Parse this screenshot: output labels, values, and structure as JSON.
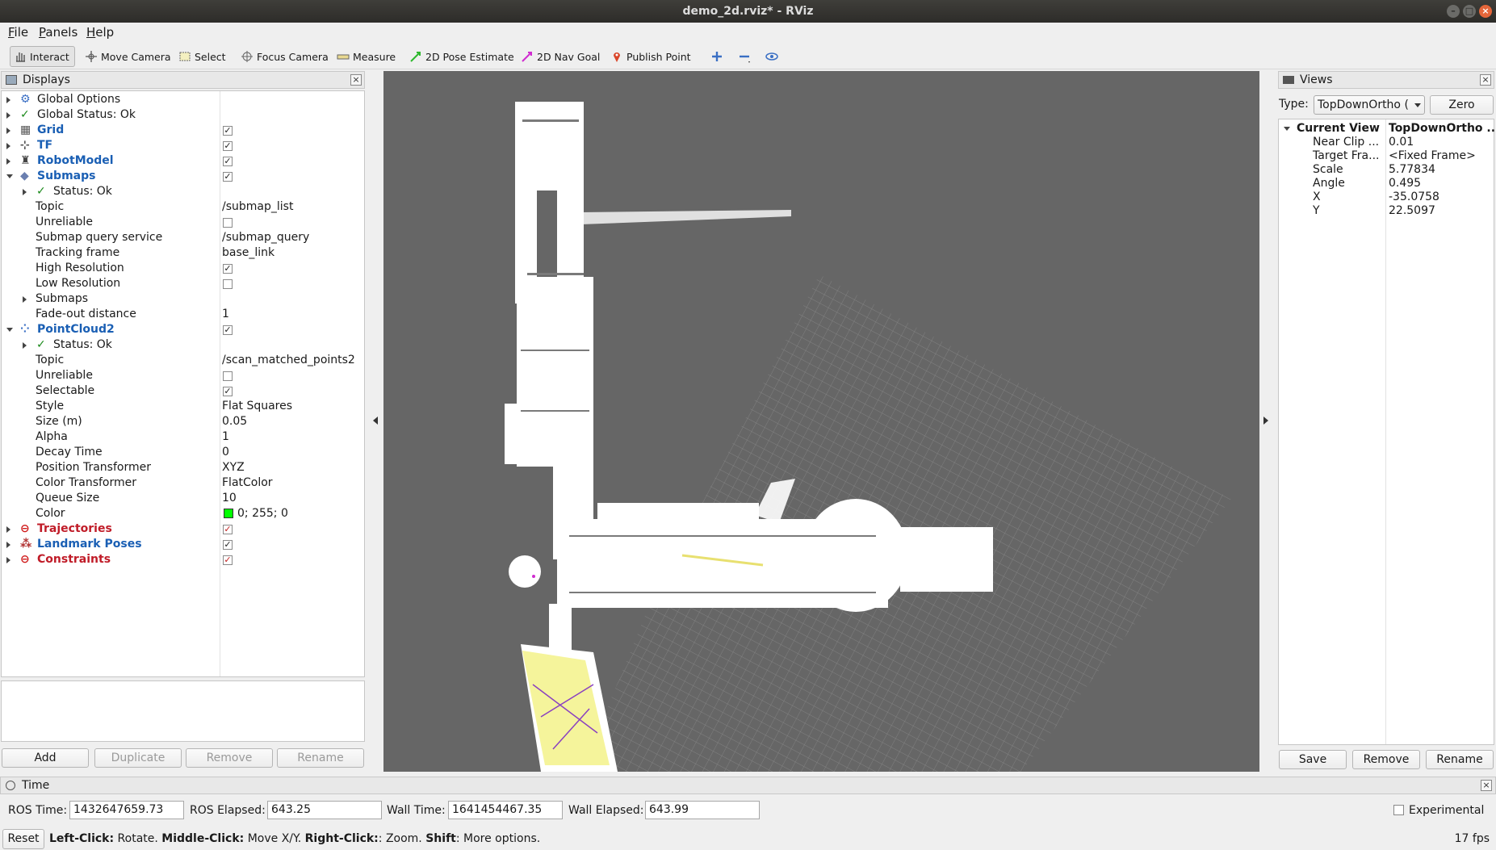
{
  "window": {
    "title": "demo_2d.rviz* - RViz"
  },
  "menu": [
    {
      "label": "File",
      "u": "F",
      "rest": "ile"
    },
    {
      "label": "Panels",
      "u": "P",
      "rest": "anels"
    },
    {
      "label": "Help",
      "u": "H",
      "rest": "elp"
    }
  ],
  "toolbar": {
    "interact": "Interact",
    "move_camera": "Move Camera",
    "select": "Select",
    "focus_camera": "Focus Camera",
    "measure": "Measure",
    "pose_estimate": "2D Pose Estimate",
    "nav_goal": "2D Nav Goal",
    "publish_point": "Publish Point"
  },
  "displays": {
    "title": "Displays",
    "rows": [
      {
        "label": "Global Options",
        "value": "",
        "style": "normal",
        "icon": "gear-icon"
      },
      {
        "label": "Global Status: Ok",
        "value": "",
        "style": "normal",
        "icon": "check-icon"
      },
      {
        "label": "Grid",
        "value": "",
        "style": "blue",
        "icon": "grid-icon",
        "checked": true
      },
      {
        "label": "TF",
        "value": "",
        "style": "blue",
        "icon": "axes-icon",
        "checked": true
      },
      {
        "label": "RobotModel",
        "value": "",
        "style": "blue",
        "icon": "robot-icon",
        "checked": true
      },
      {
        "label": "Submaps",
        "value": "",
        "style": "blue",
        "icon": "diamond-icon",
        "checked": true
      },
      {
        "label": "Status: Ok",
        "value": "",
        "style": "normal",
        "icon": "check-icon"
      },
      {
        "label": "Topic",
        "value": "/submap_list"
      },
      {
        "label": "Unreliable",
        "value": "",
        "checked": false
      },
      {
        "label": "Submap query service",
        "value": "/submap_query"
      },
      {
        "label": "Tracking frame",
        "value": "base_link"
      },
      {
        "label": "High Resolution",
        "value": "",
        "checked": true
      },
      {
        "label": "Low Resolution",
        "value": "",
        "checked": false
      },
      {
        "label": "Submaps",
        "value": ""
      },
      {
        "label": "Fade-out distance",
        "value": "1"
      },
      {
        "label": "PointCloud2",
        "value": "",
        "style": "blue",
        "icon": "pointcloud-icon",
        "checked": true
      },
      {
        "label": "Status: Ok",
        "value": "",
        "icon": "check-icon"
      },
      {
        "label": "Topic",
        "value": "/scan_matched_points2"
      },
      {
        "label": "Unreliable",
        "value": "",
        "checked": false
      },
      {
        "label": "Selectable",
        "value": "",
        "checked": true
      },
      {
        "label": "Style",
        "value": "Flat Squares"
      },
      {
        "label": "Size (m)",
        "value": "0.05"
      },
      {
        "label": "Alpha",
        "value": "1"
      },
      {
        "label": "Decay Time",
        "value": "0"
      },
      {
        "label": "Position Transformer",
        "value": "XYZ"
      },
      {
        "label": "Color Transformer",
        "value": "FlatColor"
      },
      {
        "label": "Queue Size",
        "value": "10"
      },
      {
        "label": "Color",
        "value": "0; 255; 0",
        "swatch": "#00ff00"
      },
      {
        "label": "Trajectories",
        "value": "",
        "style": "red",
        "icon": "error-icon",
        "checked": true
      },
      {
        "label": "Landmark Poses",
        "value": "",
        "style": "blue",
        "icon": "markers-icon",
        "checked": true
      },
      {
        "label": "Constraints",
        "value": "",
        "style": "red",
        "icon": "error-icon",
        "checked": true
      }
    ],
    "buttons": {
      "add": "Add",
      "duplicate": "Duplicate",
      "remove": "Remove",
      "rename": "Rename"
    }
  },
  "views": {
    "title": "Views",
    "type_label": "Type:",
    "type_value": "TopDownOrtho (",
    "zero": "Zero",
    "current_view": "Current View",
    "current_view_value": "TopDownOrtho ...",
    "props": [
      {
        "label": "Near Clip ...",
        "value": "0.01"
      },
      {
        "label": "Target Fra...",
        "value": "<Fixed Frame>"
      },
      {
        "label": "Scale",
        "value": "5.77834"
      },
      {
        "label": "Angle",
        "value": "0.495"
      },
      {
        "label": "X",
        "value": "-35.0758"
      },
      {
        "label": "Y",
        "value": "22.5097"
      }
    ],
    "buttons": {
      "save": "Save",
      "remove": "Remove",
      "rename": "Rename"
    }
  },
  "time": {
    "title": "Time",
    "ros_time_label": "ROS Time:",
    "ros_time": "1432647659.73",
    "ros_elapsed_label": "ROS Elapsed:",
    "ros_elapsed": "643.25",
    "wall_time_label": "Wall Time:",
    "wall_time": "1641454467.35",
    "wall_elapsed_label": "Wall Elapsed:",
    "wall_elapsed": "643.99",
    "experimental": "Experimental"
  },
  "status": {
    "reset": "Reset",
    "h1": "Left-Click:",
    "t1": " Rotate. ",
    "h2": "Middle-Click:",
    "t2": " Move X/Y. ",
    "h3": "Right-Click:",
    "t3": ": Zoom. ",
    "h4": "Shift",
    "t4": ": More options.",
    "fps": "17 fps"
  },
  "colors": {
    "accent_blue": "#1a5fb4",
    "error_red": "#c01c28",
    "viewport_bg": "#666666"
  }
}
